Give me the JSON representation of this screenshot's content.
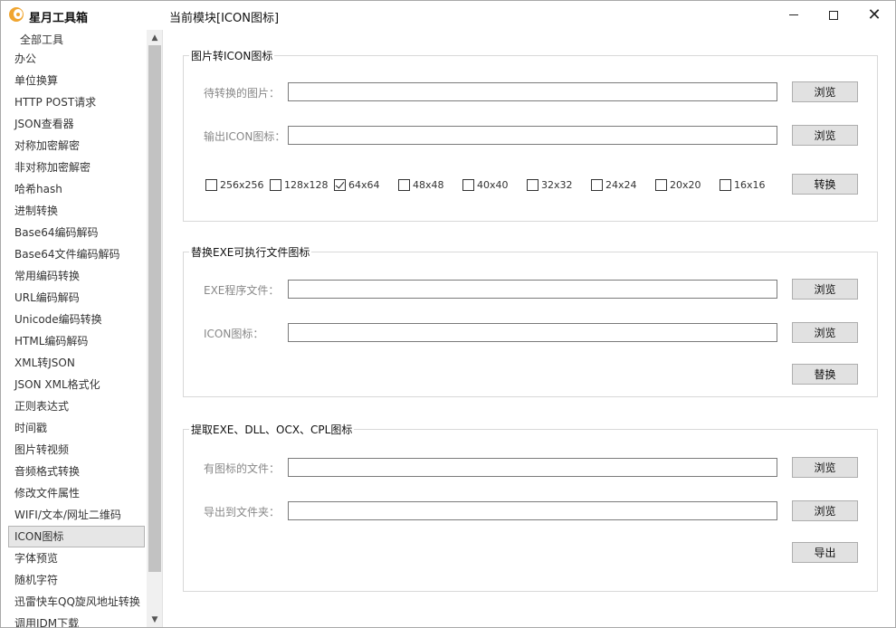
{
  "app": {
    "title": "星月工具箱",
    "module_title": "当前模块[ICON图标]",
    "window_controls": {
      "minimize": "minimize-icon",
      "maximize": "maximize-icon",
      "close": "✕"
    }
  },
  "sidebar": {
    "header": "全部工具",
    "items": [
      "办公",
      "单位换算",
      "HTTP POST请求",
      "JSON查看器",
      "对称加密解密",
      "非对称加密解密",
      "哈希hash",
      "进制转换",
      "Base64编码解码",
      "Base64文件编码解码",
      "常用编码转换",
      "URL编码解码",
      "Unicode编码转换",
      "HTML编码解码",
      "XML转JSON",
      "JSON XML格式化",
      "正则表达式",
      "时间戳",
      "图片转视频",
      "音频格式转换",
      "修改文件属性",
      "WIFI/文本/网址二维码",
      "ICON图标",
      "字体预览",
      "随机字符",
      "迅雷快车QQ旋风地址转换",
      "调用IDM下载"
    ],
    "active_item": "ICON图标",
    "scroll_up": "▲",
    "scroll_down": "▼"
  },
  "image_to_icon": {
    "title": "图片转ICON图标",
    "source_label": "待转换的图片：",
    "source_value": "",
    "output_label": "输出ICON图标：",
    "output_value": "",
    "browse": "浏览",
    "sizes": [
      {
        "label": "256x256",
        "checked": false
      },
      {
        "label": "128x128",
        "checked": false
      },
      {
        "label": "64x64",
        "checked": true
      },
      {
        "label": "48x48",
        "checked": false
      },
      {
        "label": "40x40",
        "checked": false
      },
      {
        "label": "32x32",
        "checked": false
      },
      {
        "label": "24x24",
        "checked": false
      },
      {
        "label": "20x20",
        "checked": false
      },
      {
        "label": "16x16",
        "checked": false
      }
    ],
    "convert": "转换"
  },
  "replace_exe_icon": {
    "title": "替换EXE可执行文件图标",
    "exe_label": "EXE程序文件：",
    "exe_value": "",
    "icon_label": "ICON图标：",
    "icon_value": "",
    "browse": "浏览",
    "replace": "替换"
  },
  "extract_icon": {
    "title": "提取EXE、DLL、OCX、CPL图标",
    "file_label": "有图标的文件：",
    "file_value": "",
    "folder_label": "导出到文件夹：",
    "folder_value": "",
    "browse": "浏览",
    "export": "导出"
  }
}
